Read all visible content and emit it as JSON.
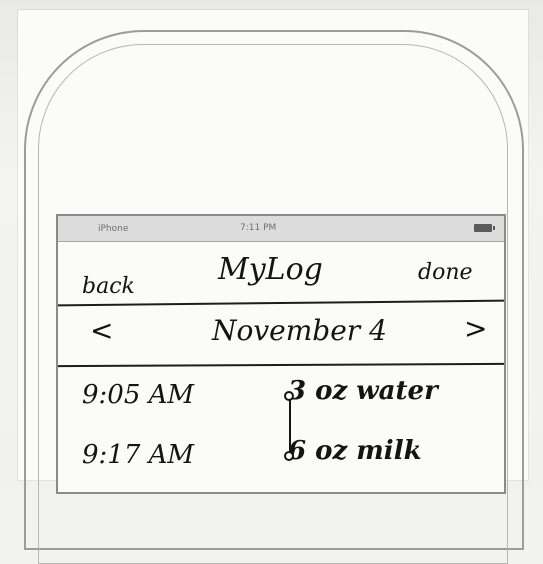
{
  "statusbar": {
    "carrier": "iPhone",
    "time": "7:11 PM",
    "battery_icon": "battery-icon"
  },
  "navbar": {
    "back_label": "back",
    "title": "MyLog",
    "done_label": "done"
  },
  "date_nav": {
    "prev_label": "<",
    "date": "November 4",
    "next_label": ">"
  },
  "log": {
    "items": [
      {
        "time": "9:05 AM",
        "entry": "3 oz water"
      },
      {
        "time": "9:17 AM",
        "entry": "6 oz milk"
      }
    ]
  },
  "colors": {
    "ink": "#141414",
    "paper": "#fbfbfa",
    "status_bar": "#dcdcdc",
    "outline": "#8a8a8a"
  }
}
